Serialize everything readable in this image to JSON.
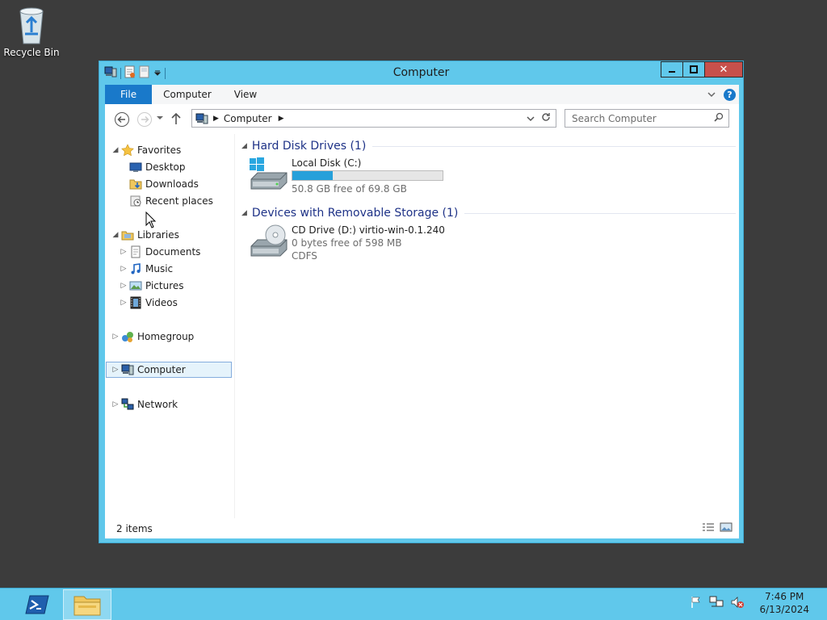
{
  "desktop": {
    "recycle_bin_label": "Recycle Bin"
  },
  "window": {
    "title": "Computer",
    "ribbon_tabs": [
      "File",
      "Computer",
      "View"
    ],
    "address": {
      "segments": [
        "Computer"
      ]
    },
    "search": {
      "placeholder": "Search Computer"
    },
    "nav": {
      "favorites": "Favorites",
      "favorites_items": [
        "Desktop",
        "Downloads",
        "Recent places"
      ],
      "libraries": "Libraries",
      "libraries_items": [
        "Documents",
        "Music",
        "Pictures",
        "Videos"
      ],
      "homegroup": "Homegroup",
      "computer": "Computer",
      "network": "Network"
    },
    "groups": {
      "hdd": {
        "header": "Hard Disk Drives (1)",
        "drive_name": "Local Disk (C:)",
        "drive_free": "50.8 GB free of 69.8 GB",
        "usage_fraction": 0.27
      },
      "removable": {
        "header": "Devices with Removable Storage (1)",
        "drive_name": "CD Drive (D:) virtio-win-0.1.240",
        "drive_free": "0 bytes free of 598 MB",
        "drive_fs": "CDFS"
      }
    },
    "status": {
      "items_count": "2 items"
    }
  },
  "taskbar": {
    "time": "7:46 PM",
    "date": "6/13/2024"
  },
  "colors": {
    "accent": "#1979ca",
    "window_frame": "#60c8eb",
    "close_button": "#c7504b",
    "group_header": "#1e3287",
    "usage_bar": "#26a0da"
  }
}
